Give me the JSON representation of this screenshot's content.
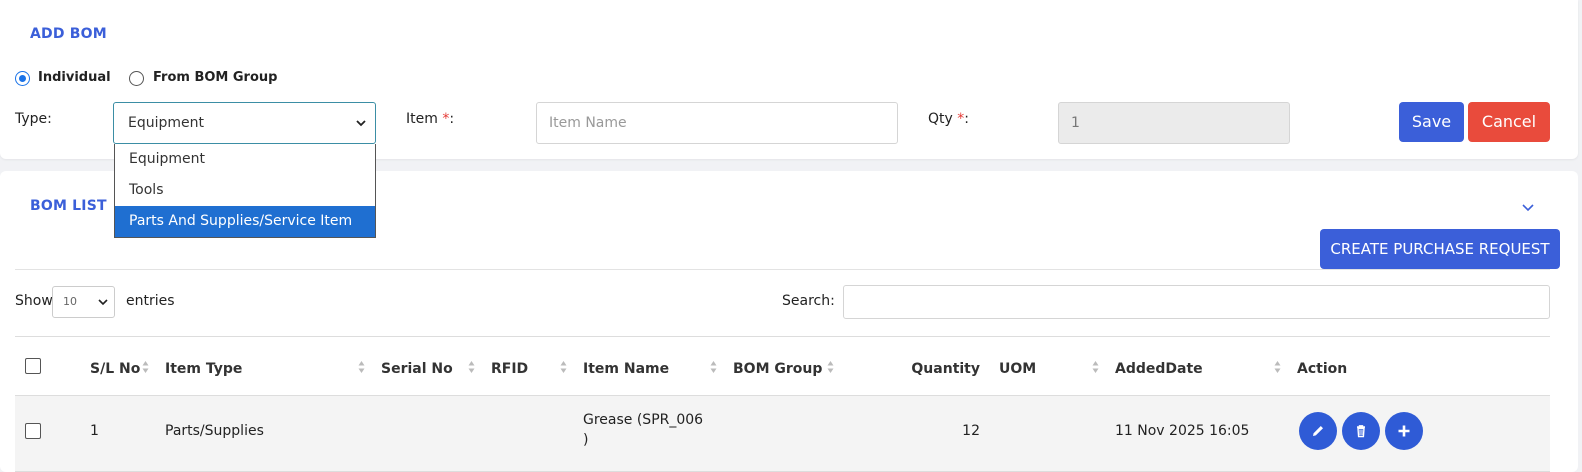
{
  "add_bom": {
    "title": "ADD BOM",
    "mode_options": [
      "Individual",
      "From BOM Group"
    ],
    "selected_mode": "Individual",
    "type_label": "Type:",
    "type_value": "Equipment",
    "type_options": [
      "Equipment",
      "Tools",
      "Parts And Supplies/Service Item"
    ],
    "type_highlighted": "Parts And Supplies/Service Item",
    "item_label": "Item ",
    "item_required": "*",
    "item_colon": ":",
    "item_placeholder": "Item Name",
    "qty_label": "Qty ",
    "qty_required": "*",
    "qty_colon": ":",
    "qty_value": "1",
    "save_label": "Save",
    "cancel_label": "Cancel"
  },
  "bom_list": {
    "title": "BOM LIST",
    "create_pr_label": "CREATE PURCHASE REQUEST",
    "show_label": "Show",
    "entries_value": "10",
    "entries_label": "entries",
    "search_label": "Search:",
    "columns": [
      "S/L No",
      "Item Type",
      "Serial No",
      "RFID",
      "Item Name",
      "BOM Group",
      "Quantity",
      "UOM",
      "AddedDate",
      "Action"
    ],
    "rows": [
      {
        "sl_no": "1",
        "item_type": "Parts/Supplies",
        "serial_no": "",
        "rfid": "",
        "item_name_line1": "Grease (SPR_006",
        "item_name_line2": ")",
        "bom_group": "",
        "quantity": "12",
        "uom": "",
        "added_date": "11 Nov 2025 16:05"
      }
    ]
  },
  "colors": {
    "accent": "#3b5fd9",
    "danger": "#e94b3c",
    "selected_option": "#1f6fd1"
  },
  "icons": [
    "chevron-down-icon",
    "sort-icon",
    "pencil-icon",
    "trash-icon",
    "plus-icon"
  ]
}
